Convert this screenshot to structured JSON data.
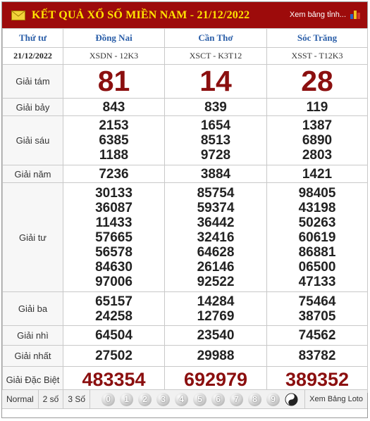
{
  "header": {
    "title": "KẾT QUẢ XỔ SỐ MIỀN NAM - 21/12/2022",
    "link": "Xem bảng tỉnh...",
    "icons": [
      "mail-icon",
      "bar-chart-icon"
    ],
    "colors": {
      "header_bg": "#9d0b0b",
      "title": "#ffe400",
      "prize_red": "#8b0f0f",
      "city_blue": "#2a5ea8"
    }
  },
  "table": {
    "weekday": "Thứ tư",
    "date": "21/12/2022",
    "provinces": [
      {
        "name": "Đồng Nai",
        "code": "XSDN - 12K3"
      },
      {
        "name": "Cần Thơ",
        "code": "XSCT - K3T12"
      },
      {
        "name": "Sóc Trăng",
        "code": "XSST - T12K3"
      }
    ],
    "prizes": [
      {
        "label": "Giải tám",
        "values": [
          [
            "81"
          ],
          [
            "14"
          ],
          [
            "28"
          ]
        ]
      },
      {
        "label": "Giải bảy",
        "values": [
          [
            "843"
          ],
          [
            "839"
          ],
          [
            "119"
          ]
        ]
      },
      {
        "label": "Giải sáu",
        "values": [
          [
            "2153",
            "6385",
            "1188"
          ],
          [
            "1654",
            "8513",
            "9728"
          ],
          [
            "1387",
            "6890",
            "2803"
          ]
        ]
      },
      {
        "label": "Giải năm",
        "values": [
          [
            "7236"
          ],
          [
            "3884"
          ],
          [
            "1421"
          ]
        ]
      },
      {
        "label": "Giải tư",
        "values": [
          [
            "30133",
            "36087",
            "11433",
            "57665",
            "56578",
            "84630",
            "97006"
          ],
          [
            "85754",
            "59374",
            "36442",
            "32416",
            "64628",
            "26146",
            "92522"
          ],
          [
            "98405",
            "43198",
            "50263",
            "60619",
            "86881",
            "06500",
            "47133"
          ]
        ]
      },
      {
        "label": "Giải ba",
        "values": [
          [
            "65157",
            "24258"
          ],
          [
            "14284",
            "12769"
          ],
          [
            "75464",
            "38705"
          ]
        ]
      },
      {
        "label": "Giải nhì",
        "values": [
          [
            "64504"
          ],
          [
            "23540"
          ],
          [
            "74562"
          ]
        ]
      },
      {
        "label": "Giải nhất",
        "values": [
          [
            "27502"
          ],
          [
            "29988"
          ],
          [
            "83782"
          ]
        ]
      },
      {
        "label": "Giải Đặc Biệt",
        "values": [
          [
            "483354"
          ],
          [
            "692979"
          ],
          [
            "389352"
          ]
        ]
      }
    ]
  },
  "footer": {
    "modes": [
      "Normal",
      "2 số",
      "3 Số"
    ],
    "digits": [
      "0",
      "1",
      "2",
      "3",
      "4",
      "5",
      "6",
      "7",
      "8",
      "9"
    ],
    "loto": "Xem Bảng Loto"
  }
}
